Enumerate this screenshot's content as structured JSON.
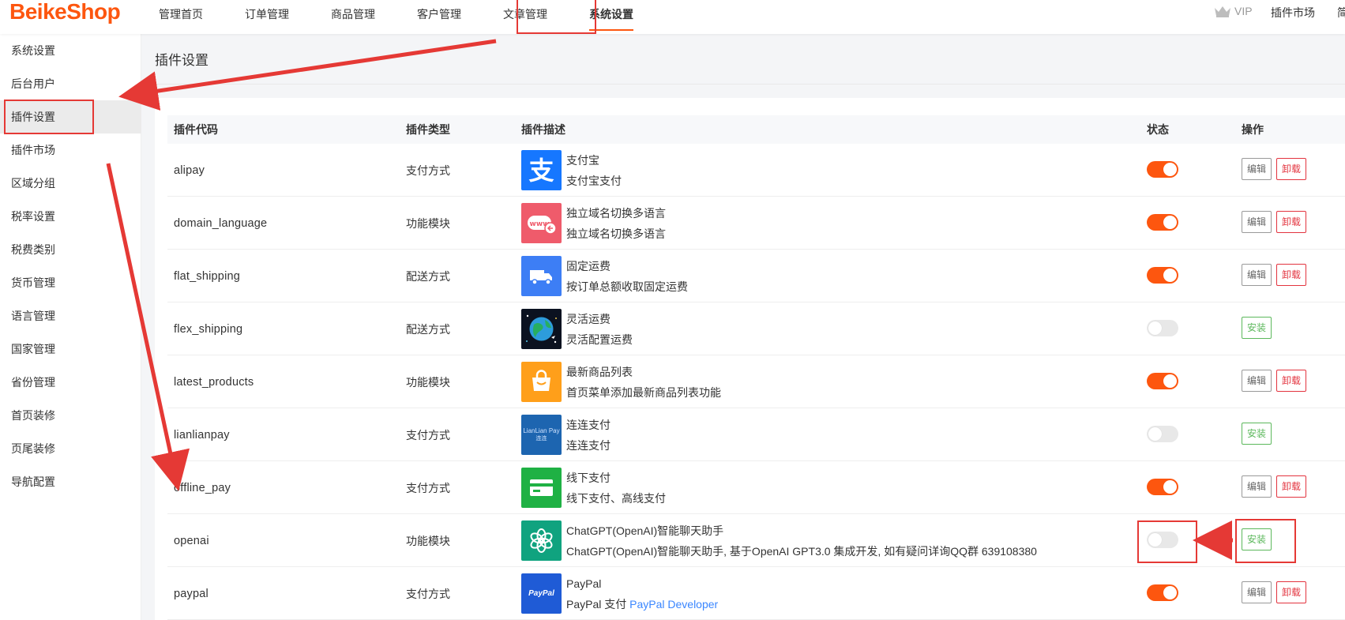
{
  "header": {
    "logo": "BeikeShop",
    "nav": [
      {
        "label": "管理首页"
      },
      {
        "label": "订单管理"
      },
      {
        "label": "商品管理"
      },
      {
        "label": "客户管理"
      },
      {
        "label": "文章管理"
      },
      {
        "label": "系统设置"
      }
    ],
    "vip_label": "VIP",
    "plugin_market_label": "插件市场",
    "lang_label": "简"
  },
  "sidebar": {
    "items": [
      {
        "label": "系统设置"
      },
      {
        "label": "后台用户"
      },
      {
        "label": "插件设置"
      },
      {
        "label": "插件市场"
      },
      {
        "label": "区域分组"
      },
      {
        "label": "税率设置"
      },
      {
        "label": "税费类别"
      },
      {
        "label": "货币管理"
      },
      {
        "label": "语言管理"
      },
      {
        "label": "国家管理"
      },
      {
        "label": "省份管理"
      },
      {
        "label": "首页装修"
      },
      {
        "label": "页尾装修"
      },
      {
        "label": "导航配置"
      }
    ]
  },
  "page": {
    "title": "插件设置"
  },
  "table": {
    "columns": {
      "code": "插件代码",
      "type": "插件类型",
      "desc": "插件描述",
      "status": "状态",
      "action": "操作"
    },
    "buttons": {
      "edit": "编辑",
      "uninstall": "卸载",
      "install": "安装"
    },
    "rows": [
      {
        "code": "alipay",
        "type": "支付方式",
        "name": "支付宝",
        "desc": "支付宝支付",
        "enabled": true,
        "installed": true,
        "icon": "alipay-icon"
      },
      {
        "code": "domain_language",
        "type": "功能模块",
        "name": "独立域名切换多语言",
        "desc": "独立域名切换多语言",
        "enabled": true,
        "installed": true,
        "icon": "www-icon"
      },
      {
        "code": "flat_shipping",
        "type": "配送方式",
        "name": "固定运费",
        "desc": "按订单总额收取固定运费",
        "enabled": true,
        "installed": true,
        "icon": "truck-icon"
      },
      {
        "code": "flex_shipping",
        "type": "配送方式",
        "name": "灵活运费",
        "desc": "灵活配置运费",
        "enabled": false,
        "installed": false,
        "icon": "globe-icon"
      },
      {
        "code": "latest_products",
        "type": "功能模块",
        "name": "最新商品列表",
        "desc": "首页菜单添加最新商品列表功能",
        "enabled": true,
        "installed": true,
        "icon": "shopping-bag-icon"
      },
      {
        "code": "lianlianpay",
        "type": "支付方式",
        "name": "连连支付",
        "desc": "连连支付",
        "enabled": false,
        "installed": false,
        "icon": "lianlian-pay-icon",
        "icon_text": "LianLian Pay",
        "icon_subtext": "连连"
      },
      {
        "code": "offline_pay",
        "type": "支付方式",
        "name": "线下支付",
        "desc": "线下支付、高线支付",
        "enabled": true,
        "installed": true,
        "icon": "credit-card-icon"
      },
      {
        "code": "openai",
        "type": "功能模块",
        "name": "ChatGPT(OpenAI)智能聊天助手",
        "desc": "ChatGPT(OpenAI)智能聊天助手, 基于OpenAI GPT3.0 集成开发, 如有疑问详询QQ群 639108380",
        "enabled": false,
        "installed": false,
        "icon": "openai-icon"
      },
      {
        "code": "paypal",
        "type": "支付方式",
        "name": "PayPal",
        "desc": "PayPal 支付 ",
        "desc_link": "PayPal Developer",
        "enabled": true,
        "installed": true,
        "icon": "paypal-icon",
        "icon_text": "PayPal"
      }
    ]
  },
  "colors": {
    "brand": "#fd560f",
    "danger": "#e3343f",
    "success": "#5cb85c",
    "annotation": "#e53935",
    "link": "#3a86ff"
  }
}
